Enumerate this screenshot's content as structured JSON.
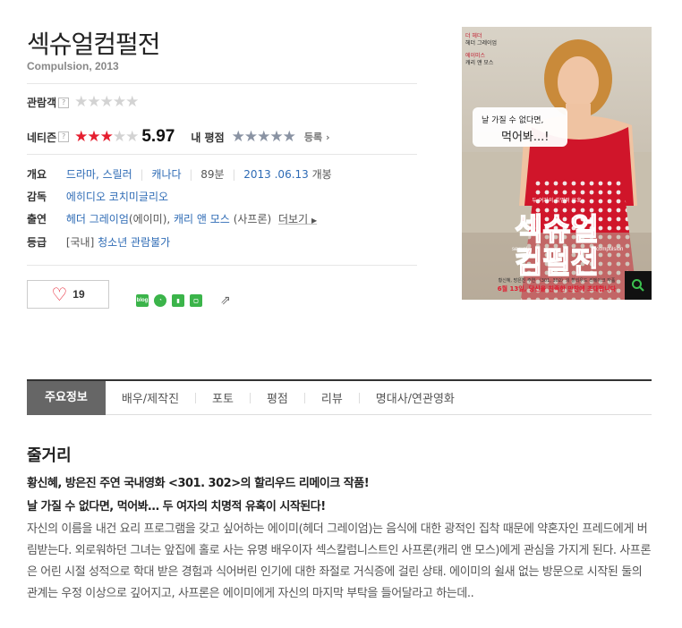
{
  "movie": {
    "title": "섹슈얼컴펄전",
    "subtitle": "Compulsion, 2013"
  },
  "ratings": {
    "audience_label": "관람객",
    "audience_help": "?",
    "audience_stars": 0,
    "netizen_label": "네티즌",
    "netizen_help": "?",
    "netizen_stars": 3,
    "netizen_score": "5.97",
    "my_label": "내 평점",
    "my_stars": 0,
    "register_label": "등록",
    "register_arrow": "›"
  },
  "info": {
    "overview_label": "개요",
    "genres": [
      "드라마",
      "스릴러"
    ],
    "country": "캐나다",
    "runtime": "89분",
    "release_date": "2013 .06.13",
    "release_suffix": "개봉",
    "director_label": "감독",
    "director": "에히디오 코치미글리오",
    "cast_label": "출연",
    "cast_1": "헤더 그레이엄",
    "cast_1_role": "(에이미)",
    "cast_2": "캐리 앤 모스",
    "cast_2_role": "(사프론)",
    "more_label": "더보기",
    "rating_label": "등급",
    "rating_region": "[국내]",
    "rating_value": "청소년 관람불가"
  },
  "actions": {
    "like_count": "19",
    "share_icons": [
      "blog",
      "talk",
      "bookmark",
      "memo"
    ],
    "share_out_icon": "share-icon"
  },
  "poster": {
    "top_small_1": "더 헤더",
    "top_small_2": "헤더 그레이엄",
    "top_small_3": "에이미스",
    "top_small_4": "캐리 앤 모스",
    "bubble_1": "날 가질 수 없다면,",
    "bubble_2": "먹어봐...!",
    "tagline_small": "두 여자의 치명적 유혹",
    "title_line_1": "섹슈얼",
    "title_line_2": "컴펄전",
    "title_en_left": "sexual",
    "title_en_right": "compulsion",
    "bottom_note": "황신혜, 방은진 주연 〈301, 302〉의 할리우드 리메이크 작품",
    "release_line": "6월 13일, 당신을 친족한 만찬에 초대합니다"
  },
  "tabs": [
    "주요정보",
    "배우/제작진",
    "포토",
    "평점",
    "리뷰",
    "명대사/연관영화"
  ],
  "synopsis": {
    "heading": "줄거리",
    "tagline_1": "황신혜, 방은진 주연 국내영화 <301. 302>의 할리우드 리메이크 작품!",
    "tagline_2": "날 가질 수 없다면, 먹어봐… 두 여자의 치명적 유혹이 시작된다!",
    "body": "자신의 이름을 내건 요리 프로그램을 갖고 싶어하는 에이미(헤더 그레이엄)는 음식에 대한 광적인 집착 때문에 약혼자인 프레드에게 버림받는다. 외로워하던 그녀는 앞집에 홀로 사는 유명 배우이자 섹스칼럼니스트인 사프론(캐리 앤 모스)에게 관심을 가지게 된다. 사프론은 어린 시절 성적으로 학대 받은 경험과 식어버린 인기에 대한 좌절로 거식증에 걸린 상태. 에이미의 쉴새 없는 방문으로 시작된 둘의 관계는 우정 이상으로 깊어지고, 사프론은 에이미에게 자신의 마지막 부탁을 들어달라고 하는데.."
  },
  "colors": {
    "accent_red": "#e51e2f",
    "link_blue": "#2e6bb5",
    "tab_active_bg": "#666666"
  }
}
